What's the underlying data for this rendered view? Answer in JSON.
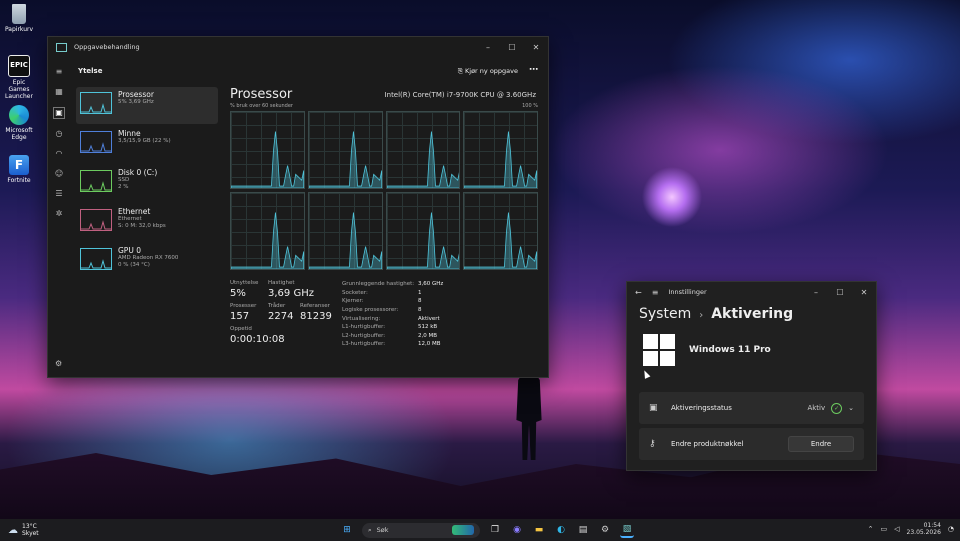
{
  "desktop": {
    "icons": [
      {
        "label": "Papirkurv",
        "icon": "recycle-bin-icon"
      },
      {
        "label": "Epic Games Launcher",
        "icon": "epic-games-icon",
        "logo_text": "EPIC"
      },
      {
        "label": "Microsoft Edge",
        "icon": "edge-icon"
      },
      {
        "label": "Fortnite",
        "icon": "fortnite-icon",
        "logo_text": "F"
      }
    ]
  },
  "task_manager": {
    "title": "Oppgavebehandling",
    "section": "Ytelse",
    "run_task_label": "Kjør ny oppgave",
    "perf_items": [
      {
        "name": "Prosessor",
        "sub1": "5% 3,69 GHz",
        "sub2": "",
        "color": "#4fc3d9"
      },
      {
        "name": "Minne",
        "sub1": "3,5/15,9 GB (22 %)",
        "sub2": "",
        "color": "#4f7fd9"
      },
      {
        "name": "Disk 0 (C:)",
        "sub1": "SSD",
        "sub2": "2 %",
        "color": "#6ccb5f"
      },
      {
        "name": "Ethernet",
        "sub1": "Ethernet",
        "sub2": "S: 0 M: 32,0 kbps",
        "color": "#c06080"
      },
      {
        "name": "GPU 0",
        "sub1": "AMD Radeon RX 7600",
        "sub2": "0 % (34 °C)",
        "color": "#4fc3d9"
      }
    ],
    "detail": {
      "title": "Prosessor",
      "cpu_name": "Intel(R) Core(TM) i7-9700K CPU @ 3.60GHz",
      "axis_left": "% bruk over 60 sekunder",
      "axis_right": "100 %",
      "stats": [
        {
          "label": "Utnyttelse",
          "value": "5%"
        },
        {
          "label": "Hastighet",
          "value": "3,69 GHz"
        },
        {
          "label": "Prosesser",
          "value": "157"
        },
        {
          "label": "Tråder",
          "value": "2274"
        },
        {
          "label": "Referanser",
          "value": "81239"
        },
        {
          "label": "Oppetid",
          "value": "0:00:10:08"
        }
      ],
      "specs": [
        {
          "k": "Grunnleggende hastighet:",
          "v": "3,60 GHz"
        },
        {
          "k": "Socketer:",
          "v": "1"
        },
        {
          "k": "Kjerner:",
          "v": "8"
        },
        {
          "k": "Logiske prosessorer:",
          "v": "8"
        },
        {
          "k": "Virtualisering:",
          "v": "Aktivert"
        },
        {
          "k": "L1-hurtigbuffer:",
          "v": "512 kB"
        },
        {
          "k": "L2-hurtigbuffer:",
          "v": "2,0 MB"
        },
        {
          "k": "L3-hurtigbuffer:",
          "v": "12,0 MB"
        }
      ]
    }
  },
  "settings": {
    "title": "Innstillinger",
    "breadcrumb_parent": "System",
    "breadcrumb_current": "Aktivering",
    "product": "Windows 11 Pro",
    "activation_label": "Aktiveringsstatus",
    "activation_value": "Aktiv",
    "change_key_label": "Endre produktnøkkel",
    "change_button": "Endre"
  },
  "taskbar": {
    "temp": "13°C",
    "weather": "Skyet",
    "search_placeholder": "Søk",
    "time": "01:54",
    "date": "23.05.2026"
  },
  "colors": {
    "accent": "#4fc3d9",
    "success": "#6ccb5f"
  }
}
